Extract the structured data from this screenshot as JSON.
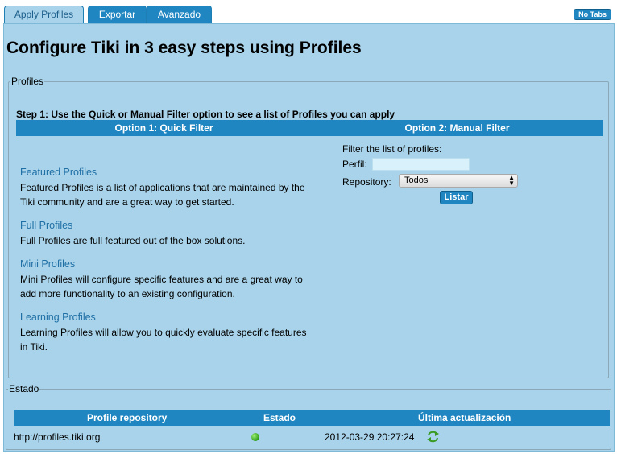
{
  "tabs": [
    {
      "label": "Apply Profiles",
      "active": true
    },
    {
      "label": "Exportar",
      "active": false
    },
    {
      "label": "Avanzado",
      "active": false
    }
  ],
  "no_tabs_label": "No Tabs",
  "page_title": "Configure Tiki in 3 easy steps using Profiles",
  "profiles_section": {
    "legend": "Profiles",
    "step_text": "Step 1: Use the Quick or Manual Filter option to see a list of Profiles you can apply",
    "option1_header": "Option 1: Quick Filter",
    "option2_header": "Option 2: Manual Filter",
    "quick_filters": [
      {
        "title": "Featured Profiles",
        "description": "Featured Profiles is a list of applications that are maintained by the Tiki community and are a great way to get started."
      },
      {
        "title": "Full Profiles",
        "description": "Full Profiles are full featured out of the box solutions."
      },
      {
        "title": "Mini Profiles",
        "description": "Mini Profiles will configure specific features and are a great way to add more functionality to an existing configuration."
      },
      {
        "title": "Learning Profiles",
        "description": "Learning Profiles will allow you to quickly evaluate specific features in Tiki."
      }
    ],
    "manual_filter": {
      "intro": "Filter the list of profiles:",
      "perfil_label": "Perfil:",
      "perfil_value": "",
      "repository_label": "Repository:",
      "repository_selected": "Todos",
      "submit_label": "Listar"
    }
  },
  "estado_section": {
    "legend": "Estado",
    "headers": [
      "Profile repository",
      "Estado",
      "Última actualización"
    ],
    "rows": [
      {
        "repository": "http://profiles.tiki.org",
        "status_color": "#3fbf1f",
        "last_update": "2012-03-29 20:27:24"
      }
    ]
  },
  "colors": {
    "accent": "#1f86c1",
    "panel_bg": "#a8d3ea",
    "link": "#1f6fa5"
  },
  "icons": {
    "status": "green-status-dot-icon",
    "refresh": "refresh-icon",
    "select_arrows": "select-updown-arrows-icon"
  }
}
